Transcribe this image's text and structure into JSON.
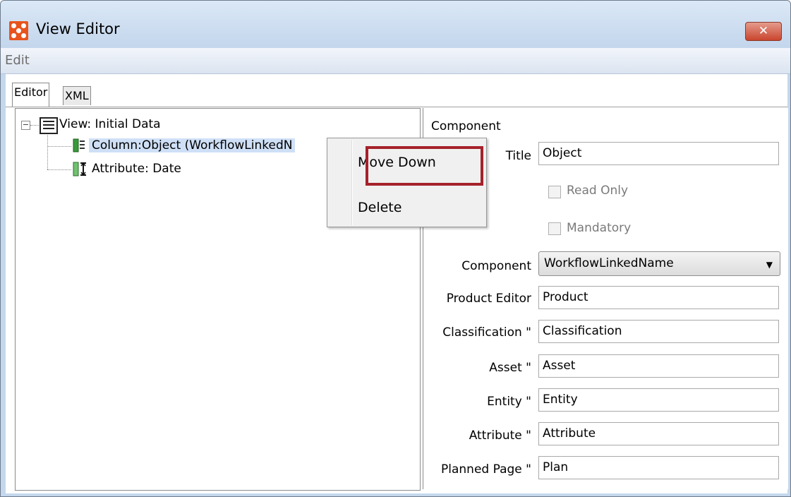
{
  "window": {
    "title": "View Editor",
    "close_glyph": "✕"
  },
  "menu": {
    "edit": "Edit"
  },
  "tabs": {
    "editor": "Editor",
    "xml": "XML"
  },
  "tree": {
    "root": "View: Initial Data",
    "column": "Column:Object (WorkflowLinkedN",
    "attribute": "Attribute: Date"
  },
  "context_menu": {
    "move_down": "Move Down",
    "delete": "Delete"
  },
  "component_panel": {
    "heading": "Component",
    "title_label": "Title",
    "title_value": "Object",
    "read_only_label": "Read Only",
    "mandatory_label": "Mandatory",
    "component_label": "Component",
    "component_value": "WorkflowLinkedName",
    "product_editor_label": "Product Editor",
    "product_editor_value": "Product",
    "classification_label": "Classification \"",
    "classification_value": "Classification",
    "asset_label": "Asset \"",
    "asset_value": "Asset",
    "entity_label": "Entity \"",
    "entity_value": "Entity",
    "attribute_label": "Attribute \"",
    "attribute_value": "Attribute",
    "planned_page_label": "Planned Page \"",
    "planned_page_value": "Plan"
  },
  "colors": {
    "titlebar": "#c3d6ec",
    "app_icon": "#e8541c",
    "close_button": "#c9452e",
    "selection": "#cfe0f6",
    "highlight_box": "#a5212b"
  },
  "icons": [
    "app-icon",
    "close-icon",
    "collapse-icon",
    "view-icon",
    "column-icon",
    "attribute-icon",
    "dropdown-arrow-icon"
  ]
}
